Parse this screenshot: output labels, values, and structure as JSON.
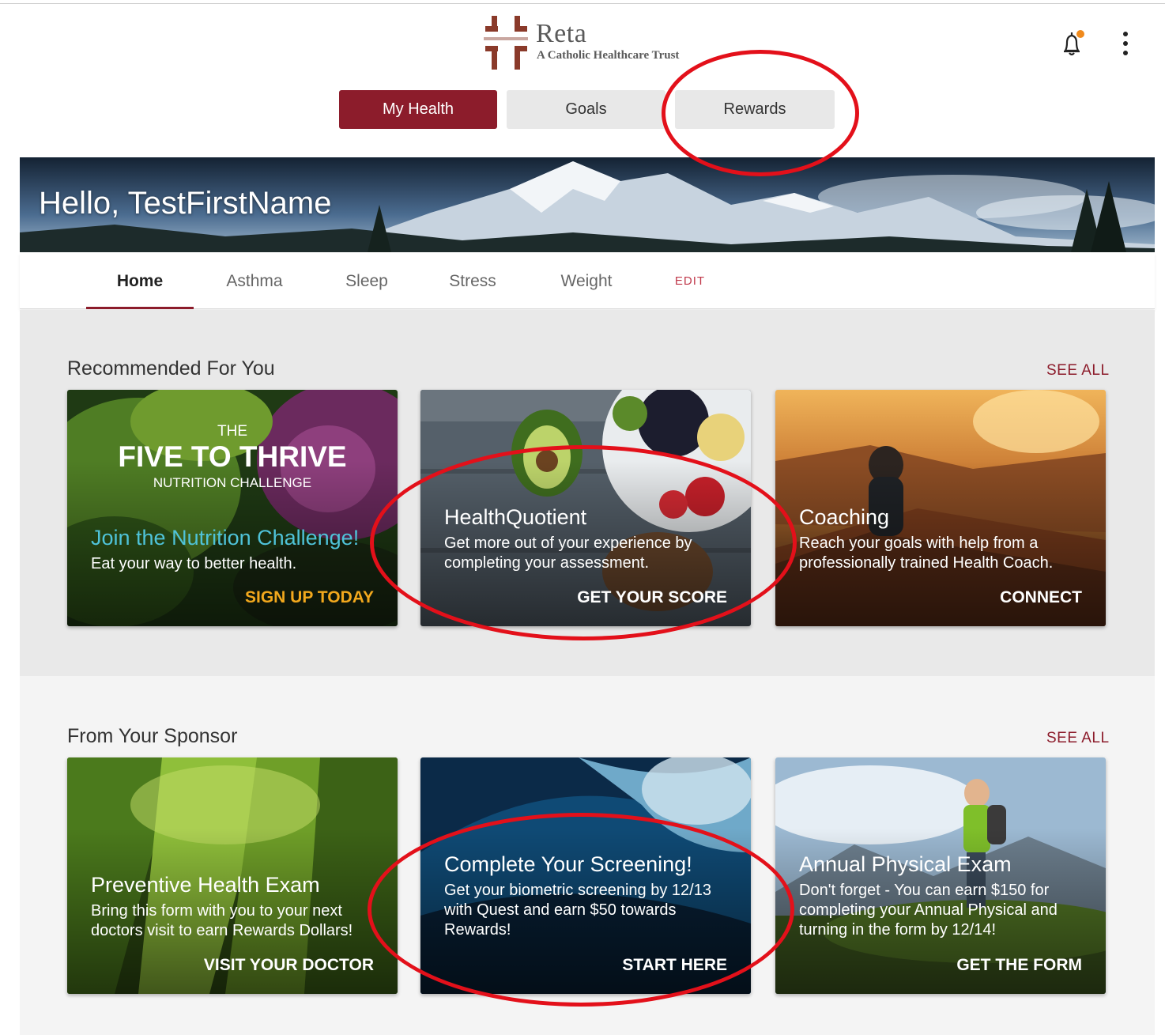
{
  "header": {
    "logo_name": "Reta",
    "logo_tagline": "A Catholic Healthcare Trust",
    "notification_color": "#f08a1c"
  },
  "main_tabs": [
    {
      "label": "My Health",
      "active": true
    },
    {
      "label": "Goals",
      "active": false
    },
    {
      "label": "Rewards",
      "active": false
    }
  ],
  "hero": {
    "greeting": "Hello, TestFirstName"
  },
  "subnav": {
    "items": [
      "Home",
      "Asthma",
      "Sleep",
      "Stress",
      "Weight"
    ],
    "active": "Home",
    "edit_label": "EDIT"
  },
  "recommended": {
    "title": "Recommended For You",
    "see_all": "SEE ALL",
    "cards": [
      {
        "banner_small": "THE",
        "banner_main": "FIVE TO THRIVE",
        "banner_sub": "NUTRITION CHALLENGE",
        "title": "Join the Nutrition Challenge!",
        "description": "Eat your way to better health.",
        "cta": "SIGN UP TODAY"
      },
      {
        "title": "HealthQuotient",
        "description": "Get more out of your experience by completing your assessment.",
        "cta": "GET YOUR SCORE"
      },
      {
        "title": "Coaching",
        "description": "Reach your goals with help from a professionally trained Health Coach.",
        "cta": "CONNECT"
      }
    ]
  },
  "sponsor": {
    "title": "From Your Sponsor",
    "see_all": "SEE ALL",
    "cards": [
      {
        "title": "Preventive Health Exam",
        "description": "Bring this form with you to your next doctors visit to earn Rewards Dollars!",
        "cta": "VISIT YOUR DOCTOR"
      },
      {
        "title": "Complete Your Screening!",
        "description": "Get your biometric screening by 12/13 with Quest and earn $50 towards Rewards!",
        "cta": "START HERE"
      },
      {
        "title": "Annual Physical Exam",
        "description": "Don't forget - You can earn $150 for completing your Annual Physical and turning in the form by 12/14!",
        "cta": "GET THE FORM"
      }
    ]
  },
  "colors": {
    "brand": "#8c1c2b",
    "nutrition_title": "#4fc3d9",
    "nutrition_cta": "#f2a81d",
    "annotation": "#e3101a"
  }
}
